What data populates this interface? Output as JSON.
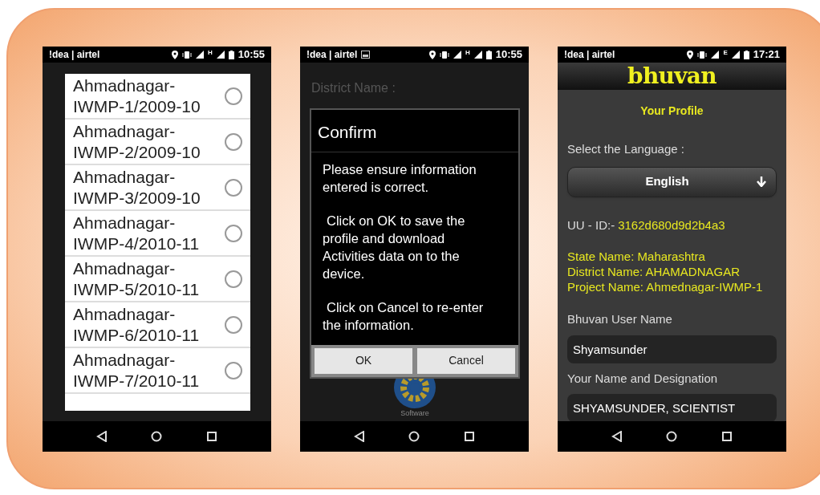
{
  "phones": [
    {
      "kind": "picker",
      "status_bar": {
        "carrier": "!dea | airtel",
        "screenshot": false,
        "network": "H",
        "time": "10:55"
      },
      "options": [
        {
          "label": "Ahmadnagar-IWMP-1/2009-10",
          "selected": false
        },
        {
          "label": "Ahmadnagar-IWMP-2/2009-10",
          "selected": false
        },
        {
          "label": "Ahmadnagar-IWMP-3/2009-10",
          "selected": false
        },
        {
          "label": "Ahmadnagar-IWMP-4/2010-11",
          "selected": false
        },
        {
          "label": "Ahmadnagar-IWMP-5/2010-11",
          "selected": false
        },
        {
          "label": "Ahmadnagar-IWMP-6/2010-11",
          "selected": false
        },
        {
          "label": "Ahmadnagar-IWMP-7/2010-11",
          "selected": false
        }
      ]
    },
    {
      "kind": "confirm",
      "status_bar": {
        "carrier": "!dea | airtel",
        "screenshot": true,
        "network": "H",
        "time": "10:55"
      },
      "background_label": "District Name :",
      "dialog": {
        "title": "Confirm",
        "paragraphs": [
          "Please ensure information entered is correct.",
          "Click on OK to save the profile and download Activities data on to the device.",
          "Click on Cancel to re-enter the information."
        ],
        "buttons": [
          "OK",
          "Cancel"
        ]
      },
      "app_label": "Software"
    },
    {
      "kind": "profile",
      "status_bar": {
        "carrier": "!dea | airtel",
        "screenshot": false,
        "network": "E",
        "time": "17:21"
      },
      "logo": "bhuvan",
      "heading": "Your Profile",
      "language_label": "Select the Language :",
      "language": "English",
      "uuid_label": "UU - ID:-",
      "uuid": "3162d680d9d2b4a3",
      "details": [
        "State Name: Maharashtra",
        "District Name: AHAMADNAGAR",
        "Project Name: Ahmednagar-IWMP-1"
      ],
      "fields": [
        {
          "label": "Bhuvan User Name",
          "value": "Shyamsunder"
        },
        {
          "label": "Your Name and Designation",
          "value": "SHYAMSUNDER, SCIENTIST"
        }
      ]
    }
  ]
}
